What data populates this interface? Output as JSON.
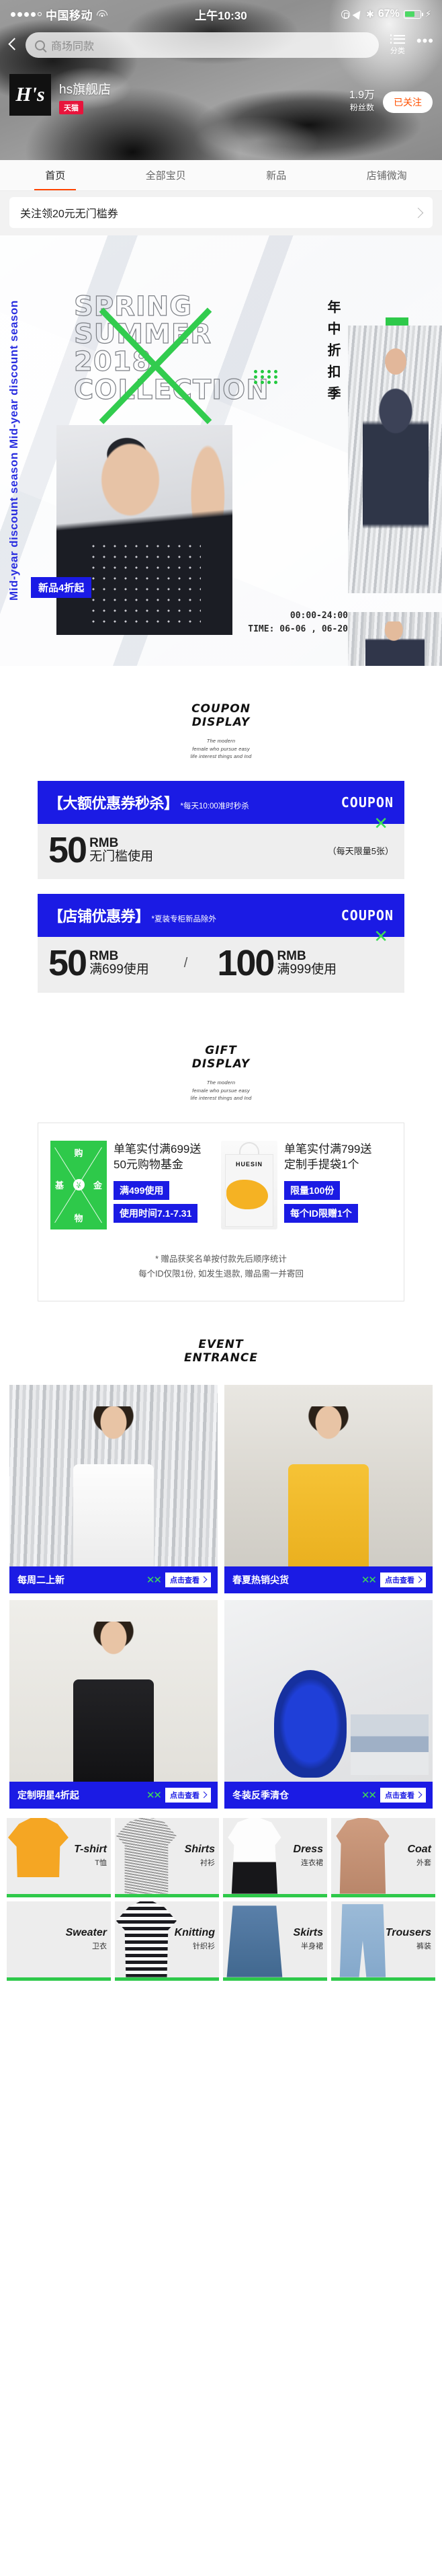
{
  "status_bar": {
    "carrier": "中国移动",
    "time": "上午10:30",
    "battery_percent": "67%",
    "signal_dots_filled": 4,
    "signal_dots_total": 5,
    "wifi_icon": "wifi-icon",
    "lock_icon": "rotation-lock-icon",
    "location_icon": "location-arrow-icon",
    "bluetooth_icon": "bluetooth-icon",
    "battery_icon": "battery-icon",
    "charging_icon": "lightning-bolt-icon"
  },
  "header": {
    "back_icon": "back-chevron-icon",
    "search": {
      "placeholder": "商场同款",
      "icon": "search-icon"
    },
    "category_label": "分类",
    "category_icon": "list-icon",
    "more_icon": "more-dots-icon",
    "shop_logo_text": "H's",
    "shop_name": "hs旗舰店",
    "mall_badge": "天猫",
    "fans_count": "1.9万",
    "fans_label": "粉丝数",
    "follow_button": "已关注",
    "accent_color": "#ff5000",
    "badge_color": "#e8143c"
  },
  "tabs": [
    {
      "label": "首页",
      "active": true
    },
    {
      "label": "全部宝贝",
      "active": false
    },
    {
      "label": "新品",
      "active": false
    },
    {
      "label": "店铺微淘",
      "active": false
    }
  ],
  "coupon_strip": {
    "label": "关注领20元无门槛券",
    "chevron_icon": "chevron-right-icon"
  },
  "hero": {
    "vertical_text": "Mid-year discount season Mid-year discount season",
    "title_lines": [
      "SPRING",
      "SUMMER",
      "2018",
      "COLLECTION"
    ],
    "chinese_vertical": "年中折扣季",
    "badge": "新品4折起",
    "time_line1": "00:00-24:00",
    "time_line2": "TIME: 06-06 , 06-20",
    "green_color": "#2ec94a",
    "blue_color": "#2b2fe0"
  },
  "coupon_section": {
    "heading_line1": "COUPON",
    "heading_line2": "DISPLAY",
    "subtitle": "The modern\nfemale who pursue easy\nlife interest things and Ind",
    "cards": [
      {
        "title": "【大额优惠券秒杀】",
        "note": "*每天10:00准时秒杀",
        "corner_label": "COUPON",
        "amounts": [
          {
            "value": "50",
            "currency": "RMB",
            "condition": "无门槛使用"
          }
        ],
        "limit": "（每天限量5张）"
      },
      {
        "title": "【店铺优惠券】",
        "note": "*夏装专柜新品除外",
        "corner_label": "COUPON",
        "amounts": [
          {
            "value": "50",
            "currency": "RMB",
            "condition": "满699使用"
          },
          {
            "value": "100",
            "currency": "RMB",
            "condition": "满999使用"
          }
        ],
        "separator": "/",
        "limit": ""
      }
    ]
  },
  "gift_section": {
    "heading_line1": "GIFT",
    "heading_line2": "DISPLAY",
    "subtitle": "The modern\nfemale who pursue easy\nlife interest things and Ind",
    "items": [
      {
        "icon_chars": [
          "购",
          "基",
          "金",
          "物"
        ],
        "icon_symbol": "¥",
        "title": "单笔实付满699送\n50元购物基金",
        "tags": [
          "满499使用",
          "使用时间7.1-7.31"
        ]
      },
      {
        "bag_brand": "HUESIN",
        "title": "单笔实付满799送\n定制手提袋1个",
        "tags": [
          "限量100份",
          "每个ID限赠1个"
        ]
      }
    ],
    "footnote_line1": "* 赠品获奖名单按付款先后顺序统计",
    "footnote_line2": "每个ID仅限1份, 如发生退款, 赠品需一并寄回"
  },
  "event_section": {
    "heading_line1": "EVENT",
    "heading_line2": "ENTRANCE",
    "cells": [
      {
        "label": "每周二上新",
        "button": "点击查看",
        "photo": "woman-white-shirt-foil"
      },
      {
        "label": "春夏热销尖货",
        "button": "点击查看",
        "photo": "woman-yellow-top"
      },
      {
        "label": "定制明星4折起",
        "button": "点击查看",
        "photo": "woman-black-tee"
      },
      {
        "label": "冬装反季清仓",
        "button": "点击查看",
        "photo": "blue-bust-sculpture"
      }
    ],
    "chevron_icon": "chevron-right-icon"
  },
  "category_grid": [
    {
      "en": "T-shirt",
      "cn": "T恤",
      "img": "ci-tshirt"
    },
    {
      "en": "Shirts",
      "cn": "衬衫",
      "img": "ci-shirt"
    },
    {
      "en": "Dress",
      "cn": "连衣裙",
      "img": "ci-dress"
    },
    {
      "en": "Coat",
      "cn": "外套",
      "img": "ci-coat"
    },
    {
      "en": "Sweater",
      "cn": "卫衣",
      "img": "ci-sweater"
    },
    {
      "en": "Knitting",
      "cn": "针织衫",
      "img": "ci-knit"
    },
    {
      "en": "Skirts",
      "cn": "半身裙",
      "img": "ci-skirt"
    },
    {
      "en": "Trousers",
      "cn": "裤装",
      "img": "ci-trouser"
    }
  ]
}
